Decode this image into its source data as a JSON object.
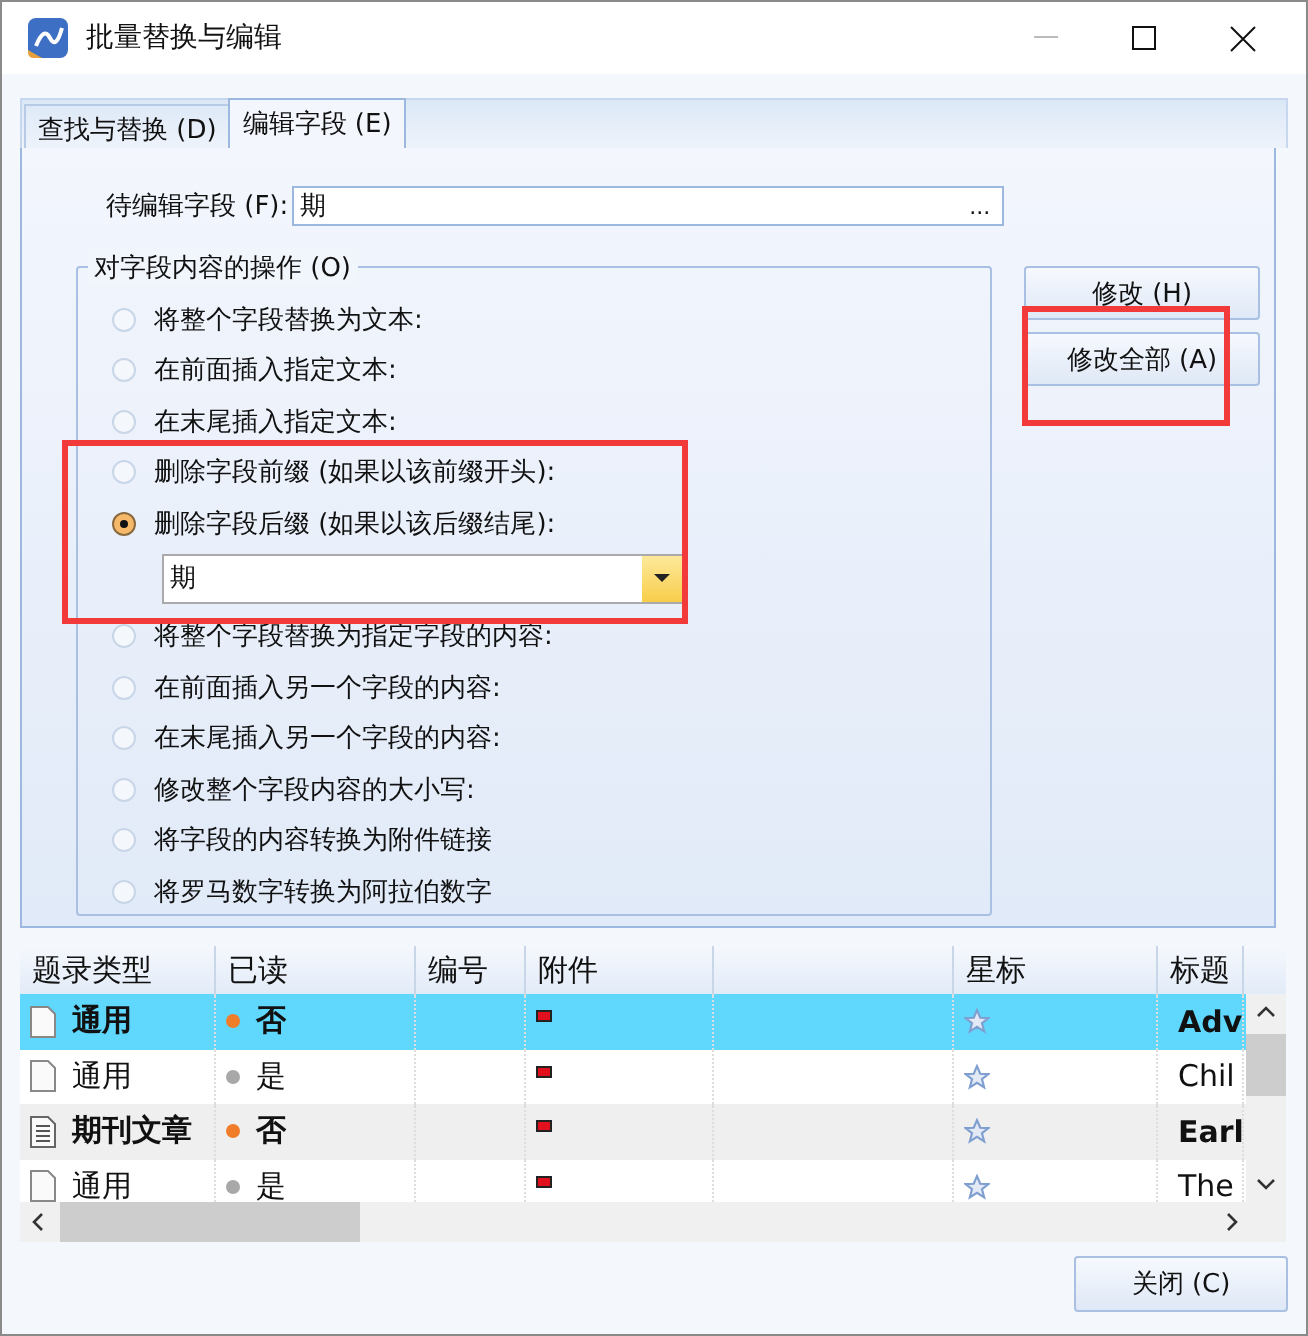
{
  "window": {
    "title": "批量替换与编辑"
  },
  "tabs": [
    {
      "label": "查找与替换 (D)",
      "selected": false
    },
    {
      "label": "编辑字段 (E)",
      "selected": true
    }
  ],
  "field": {
    "label": "待编辑字段 (F):",
    "value": "期",
    "browse": "..."
  },
  "operations": {
    "title": "对字段内容的操作 (O)",
    "options": [
      {
        "label": "将整个字段替换为文本:",
        "selected": false
      },
      {
        "label": "在前面插入指定文本:",
        "selected": false
      },
      {
        "label": "在末尾插入指定文本:",
        "selected": false
      },
      {
        "label": "删除字段前缀 (如果以该前缀开头):",
        "selected": false
      },
      {
        "label": "删除字段后缀 (如果以该后缀结尾):",
        "selected": true,
        "combo": {
          "value": "期"
        }
      },
      {
        "label": "将整个字段替换为指定字段的内容:",
        "selected": false
      },
      {
        "label": "在前面插入另一个字段的内容:",
        "selected": false
      },
      {
        "label": "在末尾插入另一个字段的内容:",
        "selected": false
      },
      {
        "label": "修改整个字段内容的大小写:",
        "selected": false
      },
      {
        "label": "将字段的内容转换为附件链接",
        "selected": false
      },
      {
        "label": "将罗马数字转换为阿拉伯数字",
        "selected": false
      }
    ]
  },
  "buttons": [
    "修改 (H)",
    "修改全部 (A)"
  ],
  "table": {
    "columns": [
      "题录类型",
      "已读",
      "编号",
      "附件",
      "",
      "星标",
      "标题"
    ],
    "rows": [
      {
        "type": "通用",
        "kind": "blank",
        "read_label": "否",
        "read": false,
        "title": "Adv",
        "selected": true
      },
      {
        "type": "通用",
        "kind": "blank",
        "read_label": "是",
        "read": true,
        "title": "Chil",
        "selected": false
      },
      {
        "type": "期刊文章",
        "kind": "lined",
        "read_label": "否",
        "read": false,
        "title": "Earl",
        "selected": false
      },
      {
        "type": "通用",
        "kind": "blank",
        "read_label": "是",
        "read": true,
        "title": "The",
        "selected": false
      }
    ]
  },
  "close_button": "关闭 (C)"
}
